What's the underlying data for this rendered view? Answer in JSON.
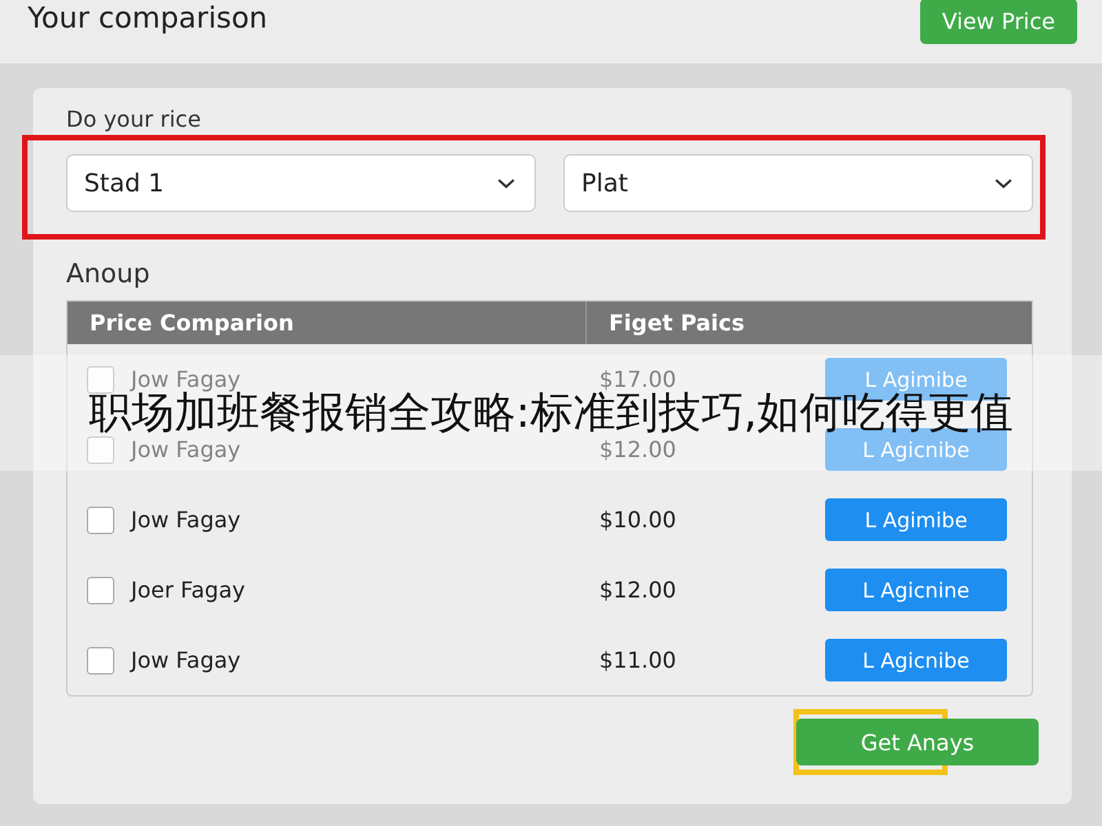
{
  "header": {
    "title": "Your comparison",
    "button": "View Price"
  },
  "form": {
    "label": "Do your rice",
    "selects": [
      {
        "value": "Stad 1"
      },
      {
        "value": "Plat"
      }
    ],
    "highlighted": true
  },
  "table": {
    "title": "Anoup",
    "columns": [
      "Price Comparion",
      "Figet Paics"
    ],
    "rows": [
      {
        "checked": false,
        "name": "Jow Fagay",
        "price": "$17.00",
        "action": "L Agimibe"
      },
      {
        "checked": false,
        "name": "Jow Fagay",
        "price": "$12.00",
        "action": "L Agicnibe"
      },
      {
        "checked": false,
        "name": "Jow Fagay",
        "price": "$10.00",
        "action": "L Agimibe"
      },
      {
        "checked": false,
        "name": "Joer Fagay",
        "price": "$12.00",
        "action": "L Agicnine"
      },
      {
        "checked": false,
        "name": "Jow Fagay",
        "price": "$11.00",
        "action": "L Agicnibe"
      }
    ]
  },
  "footer": {
    "button": "Get Anays",
    "highlighted": true
  },
  "banner": {
    "text": "职场加班餐报销全攻略:标准到技巧,如何吃得更值"
  }
}
